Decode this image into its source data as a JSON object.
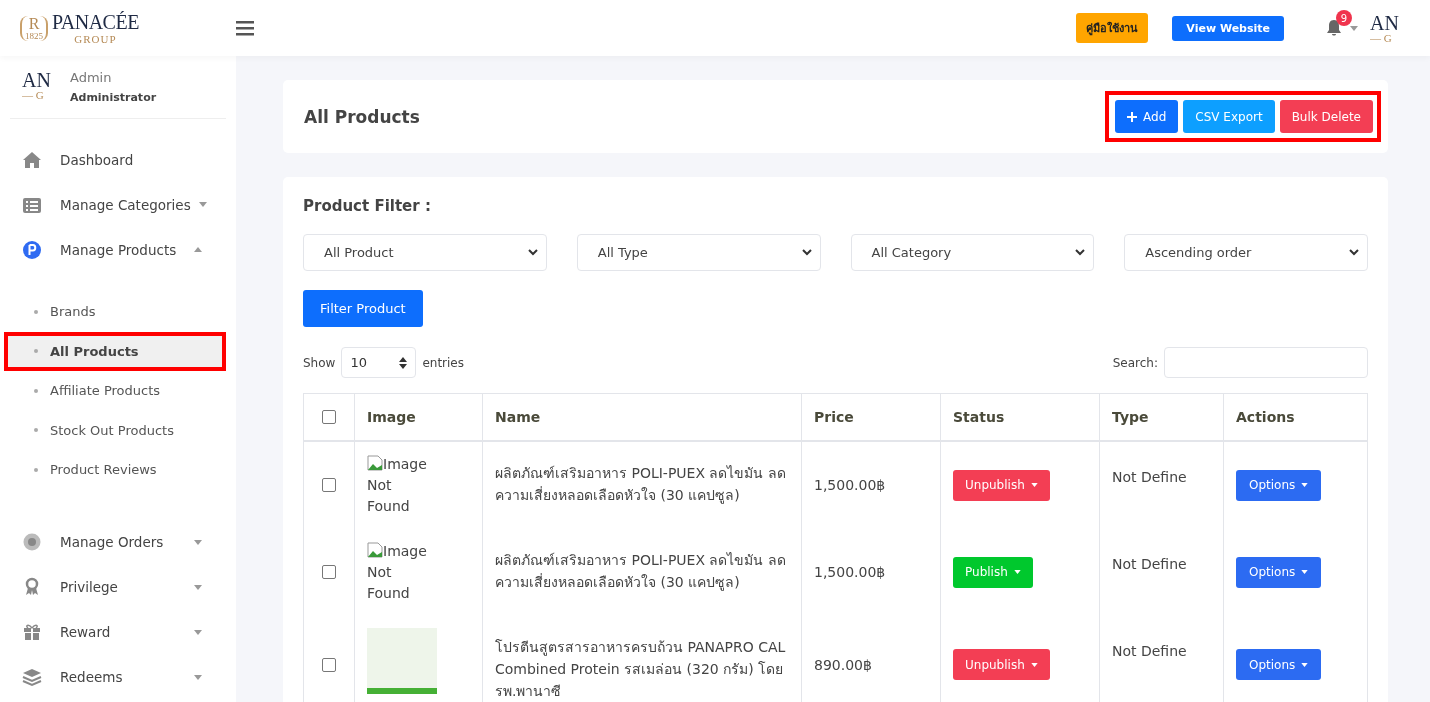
{
  "header": {
    "logo": {
      "mark": "R",
      "year": "1825",
      "title": "PANACÉE",
      "subtitle": "GROUP"
    },
    "manual_button": "คู่มือใช้งาน",
    "view_website_button": "View Website",
    "notification_count": "9",
    "avatar": {
      "line1": "AN",
      "line2": "— G"
    }
  },
  "sidebar": {
    "user": {
      "avatar": {
        "line1": "AN",
        "line2": "— G"
      },
      "name": "Admin",
      "role": "Administrator"
    },
    "items": [
      {
        "kind": "link",
        "label": "Dashboard"
      },
      {
        "kind": "menu",
        "label": "Manage Categories",
        "expanded": false
      },
      {
        "kind": "menu",
        "label": "Manage Products",
        "expanded": true,
        "children": [
          {
            "label": "Brands",
            "selected": false,
            "highlighted": false
          },
          {
            "label": "All Products",
            "selected": true,
            "highlighted": true
          },
          {
            "label": "Affiliate Products",
            "selected": false,
            "highlighted": false
          },
          {
            "label": "Stock Out Products",
            "selected": false,
            "highlighted": false
          },
          {
            "label": "Product Reviews",
            "selected": false,
            "highlighted": false
          }
        ]
      },
      {
        "kind": "menu",
        "label": "Manage Orders",
        "expanded": false
      },
      {
        "kind": "menu",
        "label": "Privilege",
        "expanded": false
      },
      {
        "kind": "menu",
        "label": "Reward",
        "expanded": false
      },
      {
        "kind": "menu",
        "label": "Redeems",
        "expanded": false
      }
    ]
  },
  "page_header": {
    "title": "All Products",
    "actions_highlighted": true,
    "actions": [
      {
        "kind": "add",
        "label": "Add"
      },
      {
        "kind": "export",
        "label": "CSV Export"
      },
      {
        "kind": "delete",
        "label": "Bulk Delete"
      }
    ]
  },
  "filter": {
    "label": "Product Filter :",
    "selects": [
      "All Product",
      "All Type",
      "All Category",
      "Ascending order"
    ],
    "button": "Filter Product"
  },
  "table_controls": {
    "show_label": "Show",
    "entries_value": "10",
    "entries_label": "entries",
    "search_label": "Search:"
  },
  "table": {
    "select_all_checked": false,
    "columns": [
      "Image",
      "Name",
      "Price",
      "Status",
      "Type",
      "Actions"
    ],
    "rows": [
      {
        "checked": false,
        "image": {
          "kind": "missing",
          "alt": "Image Not Found"
        },
        "name": "ผลิตภัณฑ์เสริมอาหาร POLI-PUEX ลดไขมัน ลดความเสี่ยงหลอดเลือดหัวใจ (30 แคปซูล)",
        "price": "1,500.00฿",
        "status": {
          "kind": "unpublish",
          "label": "Unpublish"
        },
        "type": "Not Define",
        "action": "Options"
      },
      {
        "checked": false,
        "image": {
          "kind": "missing",
          "alt": "Image Not Found"
        },
        "name": "ผลิตภัณฑ์เสริมอาหาร POLI-PUEX ลดไขมัน ลดความเสี่ยงหลอดเลือดหัวใจ (30 แคปซูล)",
        "price": "1,500.00฿",
        "status": {
          "kind": "publish",
          "label": "Publish"
        },
        "type": "Not Define",
        "action": "Options"
      },
      {
        "checked": false,
        "image": {
          "kind": "photo"
        },
        "name": "โปรตีนสูตรสารอาหารครบถ้วน PANAPRO CAL Combined Protein รสเมล่อน (320 กรัม) โดย รพ.พานาซี",
        "price": "890.00฿",
        "status": {
          "kind": "unpublish",
          "label": "Unpublish"
        },
        "type": "Not Define",
        "action": "Options"
      }
    ]
  }
}
